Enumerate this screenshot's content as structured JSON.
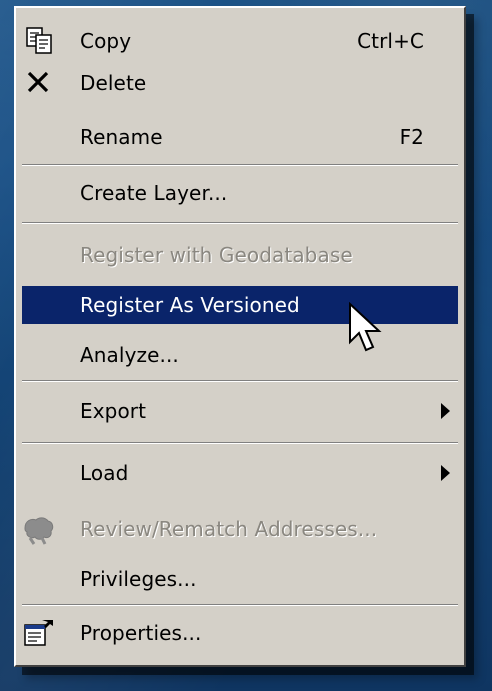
{
  "menu": {
    "items": [
      {
        "label": "Copy",
        "shortcut": "Ctrl+C",
        "icon": "copy-icon"
      },
      {
        "label": "Delete",
        "icon": "delete-x-icon"
      },
      {
        "label": "Rename",
        "shortcut": "F2"
      },
      {
        "label": "Create Layer..."
      },
      {
        "label": "Register with Geodatabase",
        "disabled": true
      },
      {
        "label": "Register As Versioned",
        "highlighted": true
      },
      {
        "label": "Analyze..."
      },
      {
        "label": "Export",
        "submenu": true
      },
      {
        "label": "Load",
        "submenu": true
      },
      {
        "label": "Review/Rematch Addresses...",
        "disabled": true,
        "icon": "geocode-icon"
      },
      {
        "label": "Privileges..."
      },
      {
        "label": "Properties...",
        "icon": "properties-icon"
      }
    ]
  },
  "colors": {
    "menu_bg": "#d4d0c8",
    "highlight": "#0a246a",
    "disabled_text": "#8a8780",
    "desktop": "#174b80"
  }
}
